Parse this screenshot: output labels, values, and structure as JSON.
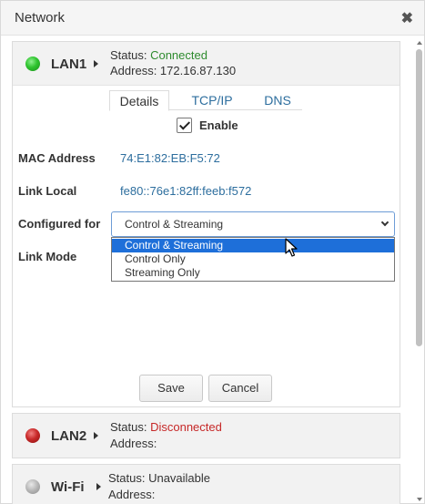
{
  "window": {
    "title": "Network",
    "close_glyph": "✖"
  },
  "panels": [
    {
      "name": "LAN1",
      "led_color": "#2fc42f",
      "status_prefix": "Status: ",
      "status_value": "Connected",
      "address_line": "Address: 172.16.87.130",
      "tabs": [
        {
          "label": "Details",
          "active": true
        },
        {
          "label": "TCP/IP",
          "active": false
        },
        {
          "label": "DNS",
          "active": false
        }
      ],
      "enable": {
        "label": "Enable",
        "checked": true
      },
      "fields": {
        "mac_label": "MAC Address",
        "mac_value": "74:E1:82:EB:F5:72",
        "link_local_label": "Link Local",
        "link_local_value": "fe80::76e1:82ff:feeb:f572",
        "configured_label": "Configured for",
        "configured_value": "Control & Streaming",
        "link_mode_label": "Link Mode"
      },
      "configured_options": [
        "Control & Streaming",
        "Control Only",
        "Streaming Only"
      ],
      "buttons": {
        "save": "Save",
        "cancel": "Cancel"
      }
    },
    {
      "name": "LAN2",
      "led_color": "#c92a2a",
      "status_prefix": "Status: ",
      "status_value": "Disconnected",
      "address_line": "Address:"
    },
    {
      "name": "Wi-Fi",
      "led_color": "#b5b5b5",
      "status_prefix": "Status: ",
      "status_value": "Unavailable",
      "address_line": "Address:"
    }
  ],
  "colors": {
    "accent_link": "#2d6e9e",
    "connected": "#2e8b2e",
    "disconnected": "#c62828",
    "selection": "#1e6fd9"
  },
  "icons": [
    "close-icon",
    "caret-right-icon",
    "check-icon",
    "chevron-down-icon",
    "mouse-pointer-icon"
  ]
}
